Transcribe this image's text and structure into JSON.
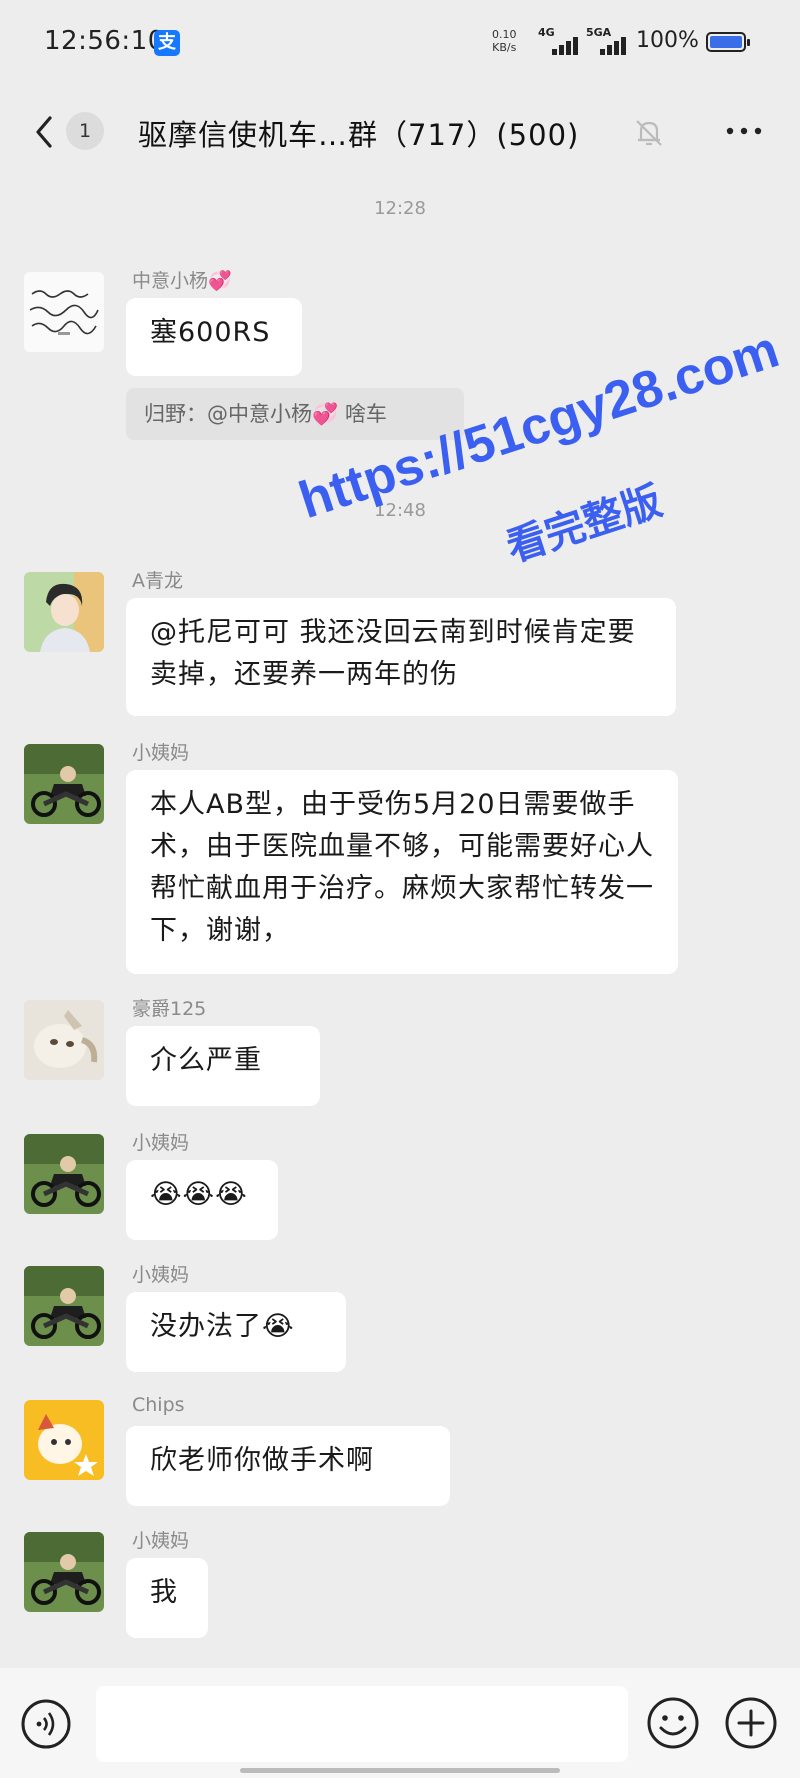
{
  "status_bar": {
    "time": "12:56:10",
    "alipay_icon": "支",
    "net_speed_value": "0.10",
    "net_speed_unit": "KB/s",
    "signal_1_label": "4G",
    "signal_2_label": "5GA",
    "battery": "100%"
  },
  "header": {
    "unread_count": "1",
    "title": "驱摩信使机车…群（717）(500)"
  },
  "timestamps": [
    "12:28",
    "12:48"
  ],
  "messages": [
    {
      "sender": "中意小杨💞",
      "text": "塞600RS"
    },
    {
      "quote": "归野：@中意小杨💞 啥车"
    },
    {
      "sender": "A青龙",
      "text": "@托尼可可  我还没回云南到时候肯定要卖掉，还要养一两年的伤"
    },
    {
      "sender": "小姨妈",
      "text": "本人AB型，由于受伤5月20日需要做手术，由于医院血量不够，可能需要好心人帮忙献血用于治疗。麻烦大家帮忙转发一下，谢谢，"
    },
    {
      "sender": "豪爵125",
      "text": "介么严重"
    },
    {
      "sender": "小姨妈",
      "text": "😭😭😭"
    },
    {
      "sender": "小姨妈",
      "text": "没办法了😭"
    },
    {
      "sender": "Chips",
      "text": "欣老师你做手术啊"
    },
    {
      "sender": "小姨妈",
      "text": "我"
    }
  ],
  "watermark": {
    "url": "https://51cgy28.com",
    "caption": "看完整版"
  },
  "input_bar": {
    "placeholder": ""
  },
  "colors": {
    "background": "#ededed",
    "bubble": "#ffffff",
    "watermark": "#3b5ff0",
    "alipay": "#1677ff"
  }
}
